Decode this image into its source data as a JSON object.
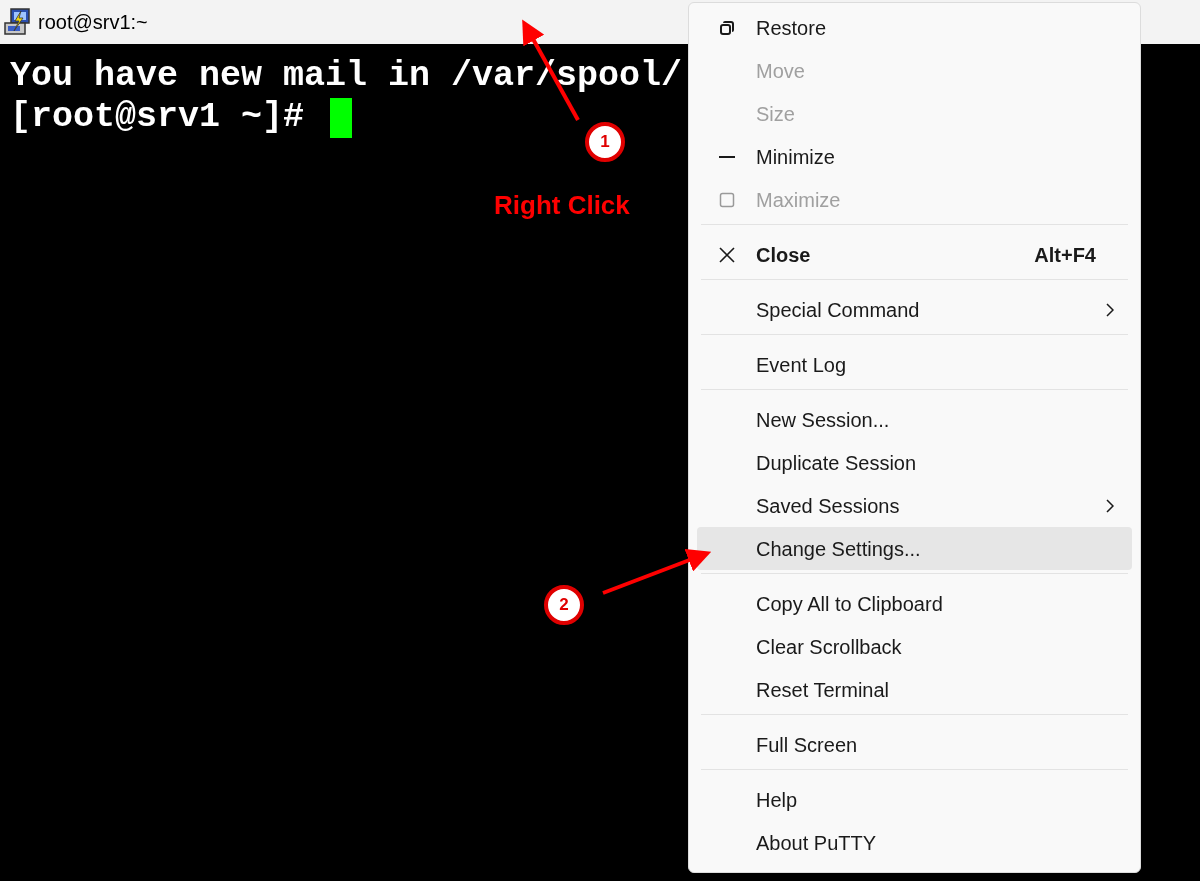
{
  "window": {
    "title": "root@srv1:~"
  },
  "terminal": {
    "lines": [
      "You have new mail in /var/spool/",
      "[root@srv1 ~]# "
    ],
    "cursor": true
  },
  "menu": {
    "groups": [
      [
        {
          "label": "Restore",
          "kind": "restore",
          "disabled": false,
          "selected": false,
          "submenu": false
        },
        {
          "label": "Move",
          "kind": "plain",
          "disabled": true,
          "selected": false,
          "submenu": false
        },
        {
          "label": "Size",
          "kind": "plain",
          "disabled": true,
          "selected": false,
          "submenu": false
        },
        {
          "label": "Minimize",
          "kind": "minimize",
          "disabled": false,
          "selected": false,
          "submenu": false
        },
        {
          "label": "Maximize",
          "kind": "maximize",
          "disabled": true,
          "selected": false,
          "submenu": false
        }
      ],
      [
        {
          "label": "Close",
          "kind": "close",
          "disabled": false,
          "selected": false,
          "submenu": false,
          "shortcut": "Alt+F4"
        }
      ],
      [
        {
          "label": "Special Command",
          "kind": "plain",
          "disabled": false,
          "selected": false,
          "submenu": true
        }
      ],
      [
        {
          "label": "Event Log",
          "kind": "plain",
          "disabled": false,
          "selected": false,
          "submenu": false
        }
      ],
      [
        {
          "label": "New Session...",
          "kind": "plain",
          "disabled": false,
          "selected": false,
          "submenu": false
        },
        {
          "label": "Duplicate Session",
          "kind": "plain",
          "disabled": false,
          "selected": false,
          "submenu": false
        },
        {
          "label": "Saved Sessions",
          "kind": "plain",
          "disabled": false,
          "selected": false,
          "submenu": true
        },
        {
          "label": "Change Settings...",
          "kind": "plain",
          "disabled": false,
          "selected": true,
          "submenu": false
        }
      ],
      [
        {
          "label": "Copy All to Clipboard",
          "kind": "plain",
          "disabled": false,
          "selected": false,
          "submenu": false
        },
        {
          "label": "Clear Scrollback",
          "kind": "plain",
          "disabled": false,
          "selected": false,
          "submenu": false
        },
        {
          "label": "Reset Terminal",
          "kind": "plain",
          "disabled": false,
          "selected": false,
          "submenu": false
        }
      ],
      [
        {
          "label": "Full Screen",
          "kind": "plain",
          "disabled": false,
          "selected": false,
          "submenu": false
        }
      ],
      [
        {
          "label": "Help",
          "kind": "plain",
          "disabled": false,
          "selected": false,
          "submenu": false
        },
        {
          "label": "About PuTTY",
          "kind": "plain",
          "disabled": false,
          "selected": false,
          "submenu": false
        }
      ]
    ]
  },
  "annotations": {
    "steps": [
      "1",
      "2"
    ],
    "caption": "Right Click"
  }
}
